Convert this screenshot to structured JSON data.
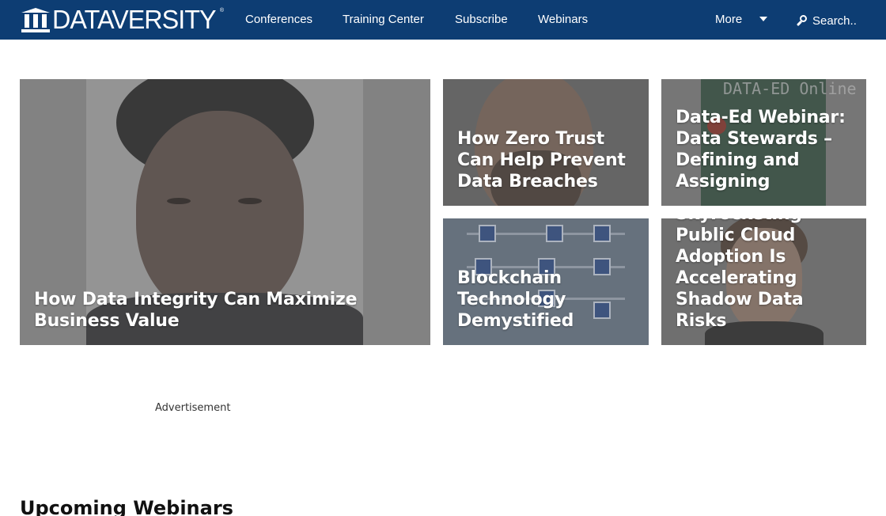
{
  "header": {
    "logo_text": "DATAVERSITY",
    "logo_registered": "®",
    "nav": [
      {
        "label": "Conferences"
      },
      {
        "label": "Training Center"
      },
      {
        "label": "Subscribe"
      },
      {
        "label": "Webinars"
      }
    ],
    "more_label": "More",
    "search_placeholder": "Search..",
    "colors": {
      "bar": "#0d3d73",
      "text": "#ffffff"
    }
  },
  "featured": [
    {
      "title": "How Data Integrity Can Maximize Business Value"
    },
    {
      "title": "How Zero Trust Can Help Prevent Data Breaches"
    },
    {
      "title": "Data-Ed Webinar: Data Stewards – Defining and Assigning",
      "image_text": "DATA-ED Online"
    },
    {
      "title": "Blockchain Technology Demystified"
    },
    {
      "title": "Skyrocketing Public Cloud Adoption Is Accelerating Shadow Data Risks"
    }
  ],
  "advertisement_label": "Advertisement",
  "sections": {
    "upcoming_webinars": "Upcoming Webinars"
  }
}
